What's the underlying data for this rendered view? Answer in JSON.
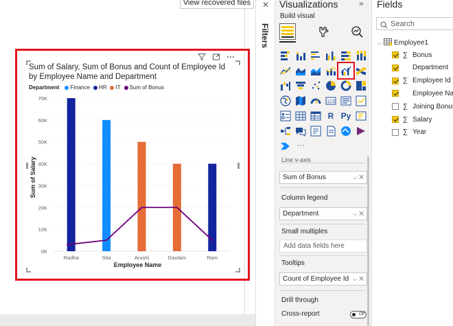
{
  "canvas": {
    "recovered_button": "View recovered files"
  },
  "visual": {
    "title": "Sum of Salary, Sum of Bonus and Count of Employee Id by Employee Name and Department",
    "header_icons": [
      "filter-icon",
      "focus-mode-icon",
      "more-options-icon"
    ]
  },
  "chart_data": {
    "type": "bar",
    "subtype": "line-and-clustered-column",
    "title": "Sum of Salary, Sum of Bonus and Count of Employee Id by Employee Name and Department",
    "xlabel": "Employee Name",
    "ylabel": "Sum of Salary",
    "ylim": [
      0,
      70000
    ],
    "yticks": [
      "0K",
      "10K",
      "20K",
      "30K",
      "40K",
      "50K",
      "60K",
      "70K"
    ],
    "ytick_values": [
      0,
      10000,
      20000,
      30000,
      40000,
      50000,
      60000,
      70000
    ],
    "legend_title": "Department",
    "legend_position": "top-left",
    "categories": [
      "Radha",
      "Sita",
      "Arushi",
      "Gautam",
      "Ram"
    ],
    "columns": [
      {
        "category": "Radha",
        "department": "HR",
        "value": 70000,
        "color": "#12239e"
      },
      {
        "category": "Sita",
        "department": "Finance",
        "value": 60000,
        "color": "#118dff"
      },
      {
        "category": "Arushi",
        "department": "IT",
        "value": 50000,
        "color": "#e66c37"
      },
      {
        "category": "Gautam",
        "department": "IT",
        "value": 40000,
        "color": "#e66c37"
      },
      {
        "category": "Ram",
        "department": "HR",
        "value": 40000,
        "color": "#12239e"
      }
    ],
    "line": {
      "name": "Sum of Bonus",
      "color": "#6b007b",
      "values": [
        3000,
        5000,
        20000,
        20000,
        5000
      ]
    },
    "legend": [
      {
        "name": "Finance",
        "color": "#118dff"
      },
      {
        "name": "HR",
        "color": "#12239e"
      },
      {
        "name": "IT",
        "color": "#e66c37"
      },
      {
        "name": "Sum of Bonus",
        "color": "#6b007b"
      }
    ]
  },
  "filters": {
    "label": "Filters",
    "close": "✕"
  },
  "visualizations": {
    "title": "Visualizations",
    "collapse": "»",
    "build_visual": "Build visual",
    "grid_icons": [
      "stacked-bar-chart-icon",
      "stacked-column-chart-icon",
      "clustered-bar-chart-icon",
      "clustered-column-chart-icon",
      "100-stacked-bar-chart-icon",
      "100-stacked-column-chart-icon",
      "line-chart-icon",
      "area-chart-icon",
      "stacked-area-chart-icon",
      "line-and-stacked-column-chart-icon",
      "line-and-clustered-column-chart-icon",
      "ribbon-chart-icon",
      "waterfall-chart-icon",
      "funnel-chart-icon",
      "scatter-chart-icon",
      "pie-chart-icon",
      "donut-chart-icon",
      "treemap-icon",
      "map-icon",
      "filled-map-icon",
      "gauge-icon",
      "card-icon",
      "multi-row-card-icon",
      "kpi-icon",
      "slicer-icon",
      "table-icon",
      "matrix-icon",
      "r-visual-icon",
      "python-visual-icon",
      "key-influencers-icon",
      "decomposition-tree-icon",
      "qa-icon",
      "smart-narrative-icon",
      "paginated-report-icon",
      "arcgis-icon",
      "power-apps-icon",
      "power-automate-icon",
      "more-visuals-icon"
    ],
    "r_label": "R",
    "py_label": "Py",
    "more_label": "···",
    "cut_label": "Line y-axis",
    "wells": [
      {
        "label": "",
        "field": "Sum of Bonus"
      },
      {
        "label": "Column legend",
        "field": "Department"
      },
      {
        "label": "Small multiples",
        "placeholder": "Add data fields here"
      },
      {
        "label": "Tooltips",
        "field": "Count of Employee Id"
      }
    ],
    "drill_through": "Drill through",
    "cross_report": "Cross-report",
    "toggle_state": "Off"
  },
  "fields": {
    "title": "Fields",
    "search_placeholder": "Search",
    "table_name": "Employee1",
    "items": [
      {
        "name": "Bonus",
        "checked": true,
        "sigma": true
      },
      {
        "name": "Department",
        "checked": true,
        "sigma": false
      },
      {
        "name": "Employee Id",
        "checked": true,
        "sigma": true
      },
      {
        "name": "Employee Name",
        "checked": true,
        "sigma": false
      },
      {
        "name": "Joining Bonus",
        "checked": false,
        "sigma": true
      },
      {
        "name": "Salary",
        "checked": true,
        "sigma": true
      },
      {
        "name": "Year",
        "checked": false,
        "sigma": true
      }
    ],
    "sigma_symbol": "∑"
  }
}
